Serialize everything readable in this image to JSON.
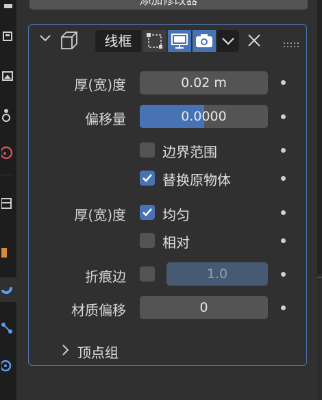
{
  "header": {
    "add_modifier_label": "添加修改器",
    "modifier_name": "线框"
  },
  "fields": {
    "thickness_label": "厚(宽)度",
    "thickness_value": "0.02 m",
    "offset_label": "偏移量",
    "offset_value": "0.0000",
    "offset_fill_fraction": 0.5,
    "boundary_label": "边界范围",
    "boundary_checked": false,
    "replace_original_label": "替换原物体",
    "replace_original_checked": true,
    "thickness_mode_label": "厚(宽)度",
    "even_label": "均匀",
    "even_checked": true,
    "relative_label": "相对",
    "relative_checked": false,
    "crease_label": "折痕边",
    "crease_checked": false,
    "crease_value": "1.0",
    "material_offset_label": "材质偏移",
    "material_offset_value": "0"
  },
  "subpanel": {
    "vertex_group_label": "顶点组"
  },
  "colors": {
    "accent": "#4772b3",
    "field": "#545454",
    "panel": "#303030"
  }
}
